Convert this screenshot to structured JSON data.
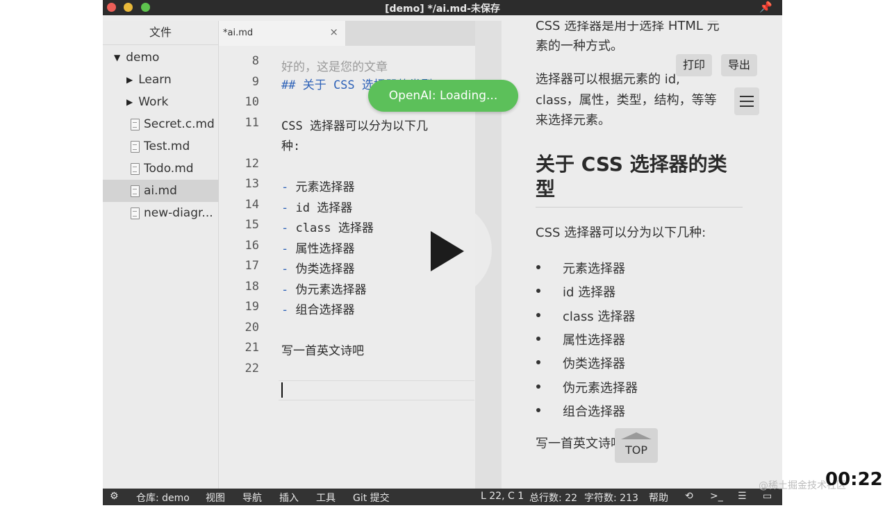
{
  "window": {
    "title": "[demo] */ai.md-未保存"
  },
  "sidebar": {
    "header": "文件",
    "items": [
      {
        "label": "demo",
        "kind": "folder-open"
      },
      {
        "label": "Learn",
        "kind": "folder"
      },
      {
        "label": "Work",
        "kind": "folder"
      },
      {
        "label": "Secret.c.md",
        "kind": "file"
      },
      {
        "label": "Test.md",
        "kind": "file"
      },
      {
        "label": "Todo.md",
        "kind": "file"
      },
      {
        "label": "ai.md",
        "kind": "file",
        "selected": true
      },
      {
        "label": "new-diagr...",
        "kind": "file"
      }
    ]
  },
  "editor": {
    "tab_label": "*ai.md",
    "tab_close": "×",
    "partial_line": "好的，这是您的文章",
    "lines": [
      {
        "n": "8",
        "text": ""
      },
      {
        "n": "9",
        "text": "## 关于 CSS 选择器的类型"
      },
      {
        "n": "10",
        "text": ""
      },
      {
        "n": "11",
        "text": "CSS 选择器可以分为以下几"
      },
      {
        "n": "",
        "text": "种:"
      },
      {
        "n": "12",
        "text": ""
      },
      {
        "n": "13",
        "dash": "-",
        "text": " 元素选择器"
      },
      {
        "n": "14",
        "dash": "-",
        "text": " id 选择器"
      },
      {
        "n": "15",
        "dash": "-",
        "text": " class 选择器"
      },
      {
        "n": "16",
        "dash": "-",
        "text": " 属性选择器"
      },
      {
        "n": "17",
        "dash": "-",
        "text": " 伪类选择器"
      },
      {
        "n": "18",
        "dash": "-",
        "text": " 伪元素选择器"
      },
      {
        "n": "19",
        "dash": "-",
        "text": " 组合选择器"
      },
      {
        "n": "20",
        "text": ""
      },
      {
        "n": "21",
        "text": "写一首英文诗吧"
      },
      {
        "n": "22",
        "text": ""
      }
    ]
  },
  "toast": {
    "text": "OpenAI: Loading..."
  },
  "preview": {
    "intro_line1": "CSS 选择器是用于选择 HTML 元",
    "intro_line2": "素的一种方式。",
    "print_button": "打印",
    "export_button": "导出",
    "para2_line1": "选择器可以根据元素的 id,",
    "para2_line2": "class，属性，类型，结构，等等",
    "para2_line3": "来选择元素。",
    "heading_line1": "关于 CSS 选择器的类",
    "heading_line2": "型",
    "para3": "CSS 选择器可以分为以下几种:",
    "list": [
      "元素选择器",
      "id 选择器",
      "class 选择器",
      "属性选择器",
      "伪类选择器",
      "伪元素选择器",
      "组合选择器"
    ],
    "last_para": "写一首英文诗吧",
    "top_button": "TOP"
  },
  "statusbar": {
    "repo": "仓库: demo",
    "menu": [
      "视图",
      "导航",
      "插入",
      "工具",
      "Git 提交"
    ],
    "position": "L 22, C 1",
    "line_count": "总行数: 22",
    "char_count": "字符数: 213",
    "help": "帮助"
  },
  "overlay": {
    "timestamp": "00:22",
    "watermark": "@稀土掘金技术社区"
  },
  "colors": {
    "toast": "#5cc05a",
    "heading": "#2f63b8",
    "statusbar": "#333333"
  }
}
